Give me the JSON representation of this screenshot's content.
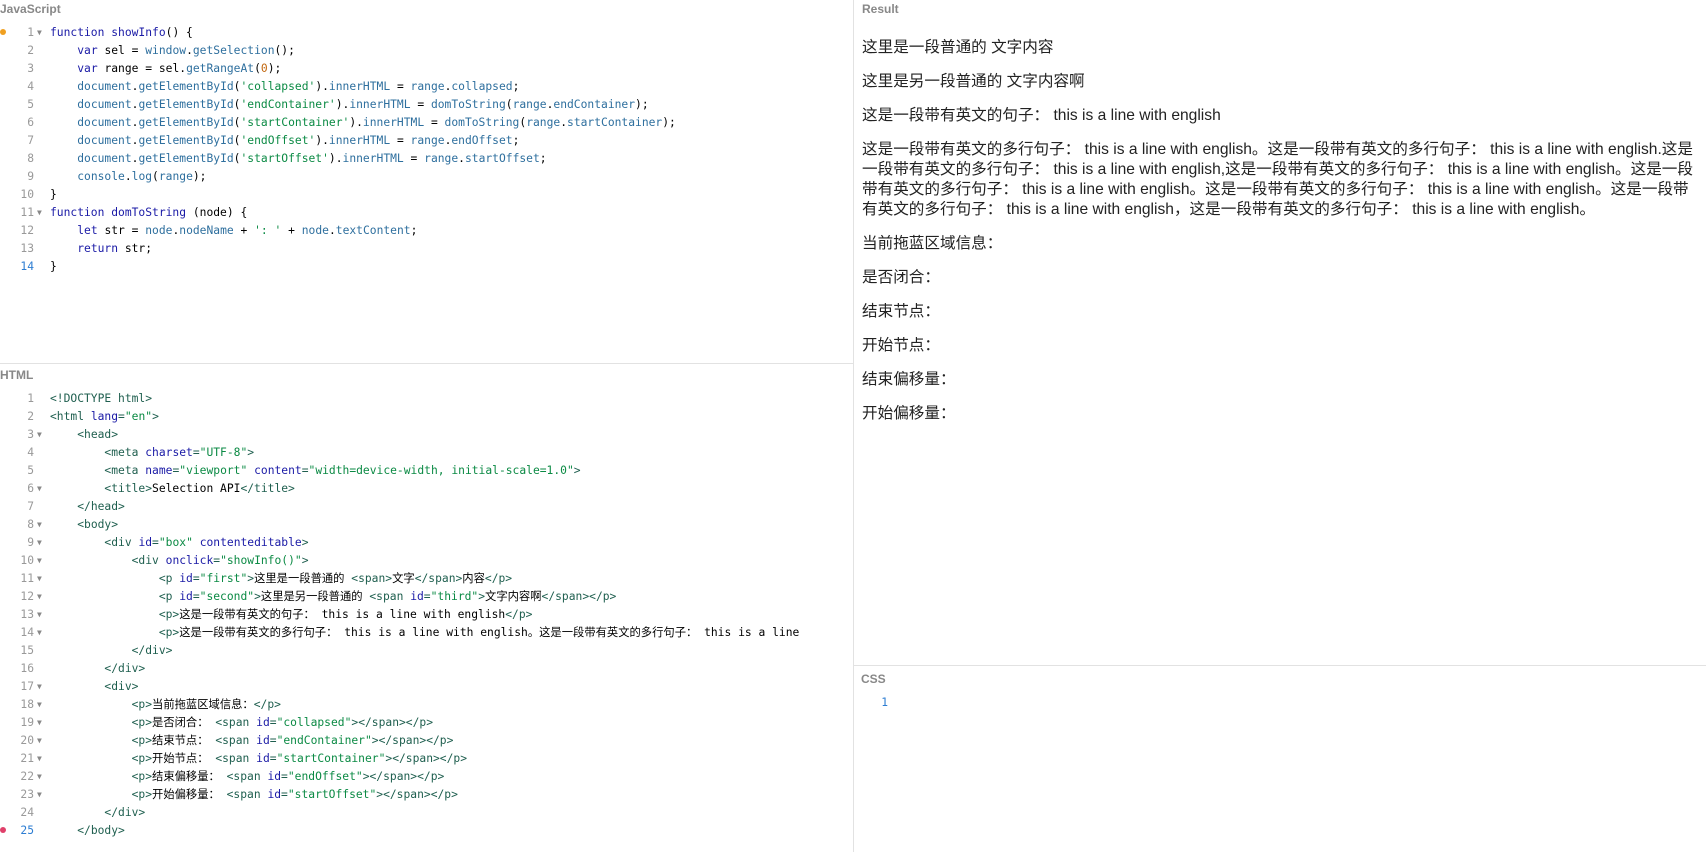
{
  "panes": {
    "js_title": "JavaScript",
    "html_title": "HTML",
    "result_title": "Result",
    "css_title": "CSS"
  },
  "js_lines": [
    {
      "n": "1",
      "segs": [
        [
          "k",
          "function "
        ],
        [
          "fn",
          "showInfo"
        ],
        [
          "",
          "() {"
        ]
      ]
    },
    {
      "n": "2",
      "segs": [
        [
          "",
          "    "
        ],
        [
          "k",
          "var "
        ],
        [
          "",
          "sel = "
        ],
        [
          "pr",
          "window"
        ],
        [
          "",
          "."
        ],
        [
          "pr",
          "getSelection"
        ],
        [
          "",
          "();"
        ]
      ]
    },
    {
      "n": "3",
      "segs": [
        [
          "",
          "    "
        ],
        [
          "k",
          "var "
        ],
        [
          "",
          "range = sel."
        ],
        [
          "pr",
          "getRangeAt"
        ],
        [
          "",
          "("
        ],
        [
          "nm",
          "0"
        ],
        [
          "",
          ");"
        ]
      ]
    },
    {
      "n": "4",
      "segs": [
        [
          "",
          "    "
        ],
        [
          "pr",
          "document"
        ],
        [
          "",
          "."
        ],
        [
          "pr",
          "getElementById"
        ],
        [
          "",
          "("
        ],
        [
          "st",
          "'collapsed'"
        ],
        [
          "",
          ")."
        ],
        [
          "pr",
          "innerHTML"
        ],
        [
          "",
          " = "
        ],
        [
          "pr",
          "range"
        ],
        [
          "",
          "."
        ],
        [
          "pr",
          "collapsed"
        ],
        [
          "",
          ";"
        ]
      ]
    },
    {
      "n": "5",
      "segs": [
        [
          "",
          "    "
        ],
        [
          "pr",
          "document"
        ],
        [
          "",
          "."
        ],
        [
          "pr",
          "getElementById"
        ],
        [
          "",
          "("
        ],
        [
          "st",
          "'endContainer'"
        ],
        [
          "",
          ")."
        ],
        [
          "pr",
          "innerHTML"
        ],
        [
          "",
          " = "
        ],
        [
          "pr",
          "domToString"
        ],
        [
          "",
          "("
        ],
        [
          "pr",
          "range"
        ],
        [
          "",
          "."
        ],
        [
          "pr",
          "endContainer"
        ],
        [
          "",
          ");"
        ]
      ]
    },
    {
      "n": "6",
      "segs": [
        [
          "",
          "    "
        ],
        [
          "pr",
          "document"
        ],
        [
          "",
          "."
        ],
        [
          "pr",
          "getElementById"
        ],
        [
          "",
          "("
        ],
        [
          "st",
          "'startContainer'"
        ],
        [
          "",
          ")."
        ],
        [
          "pr",
          "innerHTML"
        ],
        [
          "",
          " = "
        ],
        [
          "pr",
          "domToString"
        ],
        [
          "",
          "("
        ],
        [
          "pr",
          "range"
        ],
        [
          "",
          "."
        ],
        [
          "pr",
          "startContainer"
        ],
        [
          "",
          ");"
        ]
      ]
    },
    {
      "n": "7",
      "segs": [
        [
          "",
          "    "
        ],
        [
          "pr",
          "document"
        ],
        [
          "",
          "."
        ],
        [
          "pr",
          "getElementById"
        ],
        [
          "",
          "("
        ],
        [
          "st",
          "'endOffset'"
        ],
        [
          "",
          ")."
        ],
        [
          "pr",
          "innerHTML"
        ],
        [
          "",
          " = "
        ],
        [
          "pr",
          "range"
        ],
        [
          "",
          "."
        ],
        [
          "pr",
          "endOffset"
        ],
        [
          "",
          ";"
        ]
      ]
    },
    {
      "n": "8",
      "segs": [
        [
          "",
          "    "
        ],
        [
          "pr",
          "document"
        ],
        [
          "",
          "."
        ],
        [
          "pr",
          "getElementById"
        ],
        [
          "",
          "("
        ],
        [
          "st",
          "'startOffset'"
        ],
        [
          "",
          ")."
        ],
        [
          "pr",
          "innerHTML"
        ],
        [
          "",
          " = "
        ],
        [
          "pr",
          "range"
        ],
        [
          "",
          "."
        ],
        [
          "pr",
          "startOffset"
        ],
        [
          "",
          ";"
        ]
      ]
    },
    {
      "n": "9",
      "segs": [
        [
          "",
          "    "
        ],
        [
          "pr",
          "console"
        ],
        [
          "",
          "."
        ],
        [
          "pr",
          "log"
        ],
        [
          "",
          "("
        ],
        [
          "pr",
          "range"
        ],
        [
          "",
          ");"
        ]
      ]
    },
    {
      "n": "10",
      "segs": [
        [
          "",
          "}"
        ]
      ]
    },
    {
      "n": "11",
      "segs": [
        [
          "k",
          "function "
        ],
        [
          "fn",
          "domToString"
        ],
        [
          "",
          " (node) {"
        ]
      ]
    },
    {
      "n": "12",
      "segs": [
        [
          "",
          "    "
        ],
        [
          "k",
          "let "
        ],
        [
          "",
          "str = "
        ],
        [
          "pr",
          "node"
        ],
        [
          "",
          "."
        ],
        [
          "pr",
          "nodeName"
        ],
        [
          "",
          " + "
        ],
        [
          "st",
          "': '"
        ],
        [
          "",
          " + "
        ],
        [
          "pr",
          "node"
        ],
        [
          "",
          "."
        ],
        [
          "pr",
          "textContent"
        ],
        [
          "",
          ";"
        ]
      ]
    },
    {
      "n": "13",
      "segs": [
        [
          "",
          "    "
        ],
        [
          "k",
          "return "
        ],
        [
          "",
          "str;"
        ]
      ]
    },
    {
      "n": "14",
      "segs": [
        [
          "",
          "}"
        ]
      ]
    }
  ],
  "html_lines": [
    {
      "n": "1",
      "segs": [
        [
          "tg",
          "<!DOCTYPE html>"
        ]
      ]
    },
    {
      "n": "2",
      "segs": [
        [
          "tg",
          "<html "
        ],
        [
          "at",
          "lang"
        ],
        [
          "tg",
          "="
        ],
        [
          "av",
          "\"en\""
        ],
        [
          "tg",
          ">"
        ]
      ]
    },
    {
      "n": "3",
      "segs": [
        [
          "",
          "    "
        ],
        [
          "tg",
          "<head>"
        ]
      ]
    },
    {
      "n": "4",
      "segs": [
        [
          "",
          "        "
        ],
        [
          "tg",
          "<meta "
        ],
        [
          "at",
          "charset"
        ],
        [
          "tg",
          "="
        ],
        [
          "av",
          "\"UTF-8\""
        ],
        [
          "tg",
          ">"
        ]
      ]
    },
    {
      "n": "5",
      "segs": [
        [
          "",
          "        "
        ],
        [
          "tg",
          "<meta "
        ],
        [
          "at",
          "name"
        ],
        [
          "tg",
          "="
        ],
        [
          "av",
          "\"viewport\""
        ],
        [
          "",
          " "
        ],
        [
          "at",
          "content"
        ],
        [
          "tg",
          "="
        ],
        [
          "av",
          "\"width=device-width, initial-scale=1.0\""
        ],
        [
          "tg",
          ">"
        ]
      ]
    },
    {
      "n": "6",
      "segs": [
        [
          "",
          "        "
        ],
        [
          "tg",
          "<title>"
        ],
        [
          "",
          "Selection API"
        ],
        [
          "tg",
          "</title>"
        ]
      ]
    },
    {
      "n": "7",
      "segs": [
        [
          "",
          "    "
        ],
        [
          "tg",
          "</head>"
        ]
      ]
    },
    {
      "n": "8",
      "segs": [
        [
          "",
          "    "
        ],
        [
          "tg",
          "<body>"
        ]
      ]
    },
    {
      "n": "9",
      "segs": [
        [
          "",
          "        "
        ],
        [
          "tg",
          "<div "
        ],
        [
          "at",
          "id"
        ],
        [
          "tg",
          "="
        ],
        [
          "av",
          "\"box\""
        ],
        [
          "",
          " "
        ],
        [
          "at",
          "contenteditable"
        ],
        [
          "tg",
          ">"
        ]
      ]
    },
    {
      "n": "10",
      "segs": [
        [
          "",
          "            "
        ],
        [
          "tg",
          "<div "
        ],
        [
          "at",
          "onclick"
        ],
        [
          "tg",
          "="
        ],
        [
          "av",
          "\"showInfo()\""
        ],
        [
          "tg",
          ">"
        ]
      ]
    },
    {
      "n": "11",
      "segs": [
        [
          "",
          "                "
        ],
        [
          "tg",
          "<p "
        ],
        [
          "at",
          "id"
        ],
        [
          "tg",
          "="
        ],
        [
          "av",
          "\"first\""
        ],
        [
          "tg",
          ">"
        ],
        [
          "",
          "这里是一段普通的 "
        ],
        [
          "tg",
          "<span>"
        ],
        [
          "",
          "文字"
        ],
        [
          "tg",
          "</span>"
        ],
        [
          "",
          "内容"
        ],
        [
          "tg",
          "</p>"
        ]
      ]
    },
    {
      "n": "12",
      "segs": [
        [
          "",
          "                "
        ],
        [
          "tg",
          "<p "
        ],
        [
          "at",
          "id"
        ],
        [
          "tg",
          "="
        ],
        [
          "av",
          "\"second\""
        ],
        [
          "tg",
          ">"
        ],
        [
          "",
          "这里是另一段普通的 "
        ],
        [
          "tg",
          "<span "
        ],
        [
          "at",
          "id"
        ],
        [
          "tg",
          "="
        ],
        [
          "av",
          "\"third\""
        ],
        [
          "tg",
          ">"
        ],
        [
          "",
          "文字内容啊"
        ],
        [
          "tg",
          "</span></p>"
        ]
      ]
    },
    {
      "n": "13",
      "segs": [
        [
          "",
          "                "
        ],
        [
          "tg",
          "<p>"
        ],
        [
          "",
          "这是一段带有英文的句子： this is a line with english"
        ],
        [
          "tg",
          "</p>"
        ]
      ]
    },
    {
      "n": "14",
      "segs": [
        [
          "",
          "                "
        ],
        [
          "tg",
          "<p>"
        ],
        [
          "",
          "这是一段带有英文的多行句子： this is a line with english。这是一段带有英文的多行句子： this is a line"
        ]
      ]
    },
    {
      "n": "15",
      "segs": [
        [
          "",
          "            "
        ],
        [
          "tg",
          "</div>"
        ]
      ]
    },
    {
      "n": "16",
      "segs": [
        [
          "",
          "        "
        ],
        [
          "tg",
          "</div>"
        ]
      ]
    },
    {
      "n": "17",
      "segs": [
        [
          "",
          "        "
        ],
        [
          "tg",
          "<div>"
        ]
      ]
    },
    {
      "n": "18",
      "segs": [
        [
          "",
          "            "
        ],
        [
          "tg",
          "<p>"
        ],
        [
          "",
          "当前拖蓝区域信息："
        ],
        [
          "tg",
          "</p>"
        ]
      ]
    },
    {
      "n": "19",
      "segs": [
        [
          "",
          "            "
        ],
        [
          "tg",
          "<p>"
        ],
        [
          "",
          "是否闭合： "
        ],
        [
          "tg",
          "<span "
        ],
        [
          "at",
          "id"
        ],
        [
          "tg",
          "="
        ],
        [
          "av",
          "\"collapsed\""
        ],
        [
          "tg",
          "></span></p>"
        ]
      ]
    },
    {
      "n": "20",
      "segs": [
        [
          "",
          "            "
        ],
        [
          "tg",
          "<p>"
        ],
        [
          "",
          "结束节点： "
        ],
        [
          "tg",
          "<span "
        ],
        [
          "at",
          "id"
        ],
        [
          "tg",
          "="
        ],
        [
          "av",
          "\"endContainer\""
        ],
        [
          "tg",
          "></span></p>"
        ]
      ]
    },
    {
      "n": "21",
      "segs": [
        [
          "",
          "            "
        ],
        [
          "tg",
          "<p>"
        ],
        [
          "",
          "开始节点： "
        ],
        [
          "tg",
          "<span "
        ],
        [
          "at",
          "id"
        ],
        [
          "tg",
          "="
        ],
        [
          "av",
          "\"startContainer\""
        ],
        [
          "tg",
          "></span></p>"
        ]
      ]
    },
    {
      "n": "22",
      "segs": [
        [
          "",
          "            "
        ],
        [
          "tg",
          "<p>"
        ],
        [
          "",
          "结束偏移量： "
        ],
        [
          "tg",
          "<span "
        ],
        [
          "at",
          "id"
        ],
        [
          "tg",
          "="
        ],
        [
          "av",
          "\"endOffset\""
        ],
        [
          "tg",
          "></span></p>"
        ]
      ]
    },
    {
      "n": "23",
      "segs": [
        [
          "",
          "            "
        ],
        [
          "tg",
          "<p>"
        ],
        [
          "",
          "开始偏移量： "
        ],
        [
          "tg",
          "<span "
        ],
        [
          "at",
          "id"
        ],
        [
          "tg",
          "="
        ],
        [
          "av",
          "\"startOffset\""
        ],
        [
          "tg",
          "></span></p>"
        ]
      ]
    },
    {
      "n": "24",
      "segs": [
        [
          "",
          "        "
        ],
        [
          "tg",
          "</div>"
        ]
      ]
    },
    {
      "n": "25",
      "segs": [
        [
          "",
          "    "
        ],
        [
          "tg",
          "</body>"
        ]
      ]
    }
  ],
  "result": {
    "p1": "这里是一段普通的 文字内容",
    "p2": "这里是另一段普通的 文字内容啊",
    "p3": "这是一段带有英文的句子： this is a line with english",
    "p4": "这是一段带有英文的多行句子： this is a line with english。这是一段带有英文的多行句子： this is a line with english.这是一段带有英文的多行句子： this is a line with english,这是一段带有英文的多行句子： this is a line with english。这是一段带有英文的多行句子： this is a line with english。这是一段带有英文的多行句子： this is a line with english。这是一段带有英文的多行句子： this is a line with english，这是一段带有英文的多行句子： this is a line with english。",
    "p5": "当前拖蓝区域信息：",
    "p6": "是否闭合：",
    "p7": "结束节点：",
    "p8": "开始节点：",
    "p9": "结束偏移量：",
    "p10": "开始偏移量："
  },
  "css_lines": [
    {
      "n": "1",
      "segs": []
    }
  ],
  "colors": {
    "marker_js": "#f0a020",
    "marker_html": "#e0406a",
    "active_line_number": "#2d7dd2"
  }
}
